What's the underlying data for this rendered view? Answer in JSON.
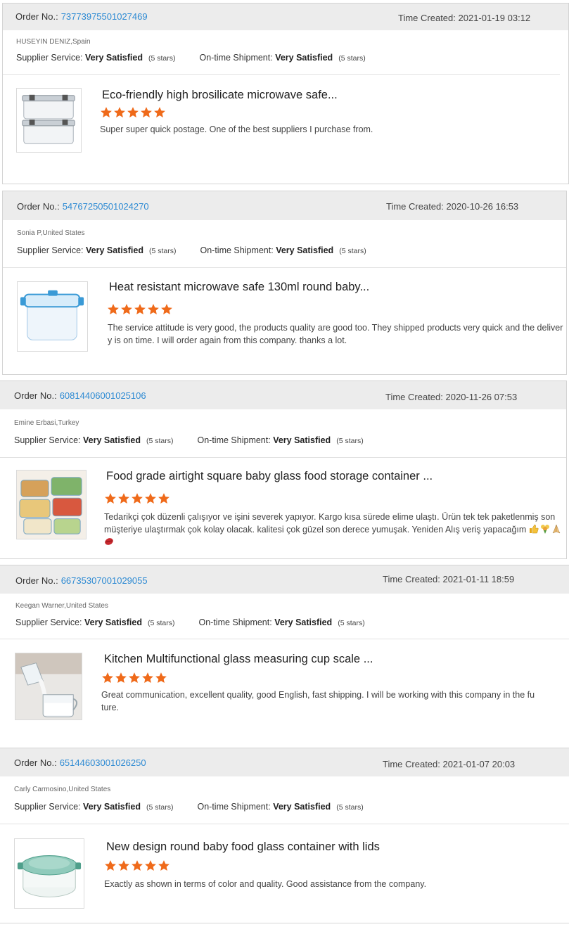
{
  "colors": {
    "link": "#2d8ad3",
    "star": "#ef6a1a",
    "header_bg": "#ececec",
    "border": "#d4d4d4"
  },
  "labels": {
    "order_prefix": "Order No.:",
    "time_prefix": "Time Created:",
    "supplier_service": "Supplier Service:",
    "ontime_shipment": "On-time Shipment:"
  },
  "reviews": [
    {
      "order_no": "73773975501027469",
      "time_created": "2021-01-19 03:12",
      "buyer": "HUSEYIN DENIZ,Spain",
      "supplier_rating": "Very Satisfied",
      "supplier_stars": "(5 stars)",
      "shipment_rating": "Very Satisfied",
      "shipment_stars": "(5 stars)",
      "product_title": "Eco-friendly high brosilicate microwave safe...",
      "stars": 5,
      "product_icon": "rectangular-glass-container-icon",
      "review_text": "Super super quick postage. One of the best suppliers I purchase from."
    },
    {
      "order_no": "54767250501024270",
      "time_created": "2020-10-26 16:53",
      "buyer": "Sonia P,United States",
      "supplier_rating": "Very Satisfied",
      "supplier_stars": "(5 stars)",
      "shipment_rating": "Very Satisfied",
      "shipment_stars": "(5 stars)",
      "product_title": "Heat resistant microwave safe 130ml round baby...",
      "stars": 5,
      "product_icon": "blue-lid-glass-container-icon",
      "review_text": "The service attitude is very good, the products quality are good too. They shipped products very quick and the delivery  is on time. I will order again from this company. thanks a lot."
    },
    {
      "order_no": "60814406001025106",
      "time_created": "2020-11-26 07:53",
      "buyer": "Emine Erbasi,Turkey",
      "supplier_rating": "Very Satisfied",
      "supplier_stars": "(5 stars)",
      "shipment_rating": "Very Satisfied",
      "shipment_stars": "(5 stars)",
      "product_title": "Food grade airtight square baby glass food storage container ...",
      "stars": 5,
      "product_icon": "food-filled-containers-icon",
      "review_text": "Tedarikçi çok düzenli çalışıyor ve işini severek yapıyor. Kargo kısa sürede elime ulaştı. Ürün tek tek paketlenmiş son müşteriye ulaştırmak çok kolay olacak. kalitesi çok güzel son derece yumuşak. Yeniden Alış veriş yapacağım",
      "review_emojis": [
        "thumbs-up-icon",
        "bouquet-icon",
        "folded-hands-icon",
        "kiss-icon"
      ]
    },
    {
      "order_no": "66735307001029055",
      "time_created": "2021-01-11 18:59",
      "buyer": "Keegan Warner,United States",
      "supplier_rating": "Very Satisfied",
      "supplier_stars": "(5 stars)",
      "shipment_rating": "Very Satisfied",
      "shipment_stars": "(5 stars)",
      "product_title": "Kitchen Multifunctional glass measuring cup scale ...",
      "stars": 5,
      "product_icon": "measuring-cup-icon",
      "review_text": "Great communication, excellent quality, good English, fast shipping. I will be working with this company in the future."
    },
    {
      "order_no": "65144603001026250",
      "time_created": "2021-01-07 20:03",
      "buyer": "Carly Carmosino,United States",
      "supplier_rating": "Very Satisfied",
      "supplier_stars": "(5 stars)",
      "shipment_rating": "Very Satisfied",
      "shipment_stars": "(5 stars)",
      "product_title": "New design round baby food glass container with lids",
      "stars": 5,
      "product_icon": "round-glass-container-icon",
      "review_text": "Exactly as shown in terms of color and quality.  Good assistance from the company."
    }
  ]
}
